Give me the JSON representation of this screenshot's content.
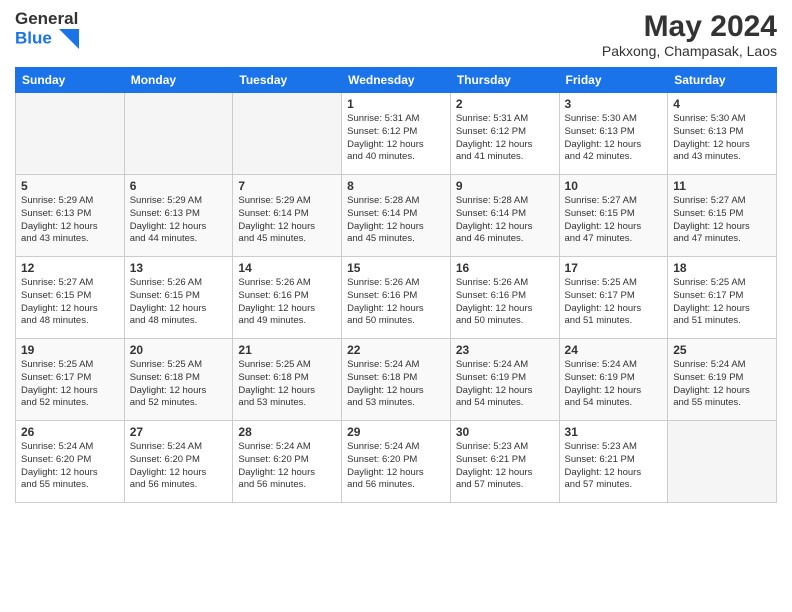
{
  "logo": {
    "line1": "General",
    "line2": "Blue"
  },
  "title": "May 2024",
  "subtitle": "Pakxong, Champasak, Laos",
  "days_of_week": [
    "Sunday",
    "Monday",
    "Tuesday",
    "Wednesday",
    "Thursday",
    "Friday",
    "Saturday"
  ],
  "weeks": [
    [
      {
        "day": "",
        "info": ""
      },
      {
        "day": "",
        "info": ""
      },
      {
        "day": "",
        "info": ""
      },
      {
        "day": "1",
        "info": "Sunrise: 5:31 AM\nSunset: 6:12 PM\nDaylight: 12 hours\nand 40 minutes."
      },
      {
        "day": "2",
        "info": "Sunrise: 5:31 AM\nSunset: 6:12 PM\nDaylight: 12 hours\nand 41 minutes."
      },
      {
        "day": "3",
        "info": "Sunrise: 5:30 AM\nSunset: 6:13 PM\nDaylight: 12 hours\nand 42 minutes."
      },
      {
        "day": "4",
        "info": "Sunrise: 5:30 AM\nSunset: 6:13 PM\nDaylight: 12 hours\nand 43 minutes."
      }
    ],
    [
      {
        "day": "5",
        "info": "Sunrise: 5:29 AM\nSunset: 6:13 PM\nDaylight: 12 hours\nand 43 minutes."
      },
      {
        "day": "6",
        "info": "Sunrise: 5:29 AM\nSunset: 6:13 PM\nDaylight: 12 hours\nand 44 minutes."
      },
      {
        "day": "7",
        "info": "Sunrise: 5:29 AM\nSunset: 6:14 PM\nDaylight: 12 hours\nand 45 minutes."
      },
      {
        "day": "8",
        "info": "Sunrise: 5:28 AM\nSunset: 6:14 PM\nDaylight: 12 hours\nand 45 minutes."
      },
      {
        "day": "9",
        "info": "Sunrise: 5:28 AM\nSunset: 6:14 PM\nDaylight: 12 hours\nand 46 minutes."
      },
      {
        "day": "10",
        "info": "Sunrise: 5:27 AM\nSunset: 6:15 PM\nDaylight: 12 hours\nand 47 minutes."
      },
      {
        "day": "11",
        "info": "Sunrise: 5:27 AM\nSunset: 6:15 PM\nDaylight: 12 hours\nand 47 minutes."
      }
    ],
    [
      {
        "day": "12",
        "info": "Sunrise: 5:27 AM\nSunset: 6:15 PM\nDaylight: 12 hours\nand 48 minutes."
      },
      {
        "day": "13",
        "info": "Sunrise: 5:26 AM\nSunset: 6:15 PM\nDaylight: 12 hours\nand 48 minutes."
      },
      {
        "day": "14",
        "info": "Sunrise: 5:26 AM\nSunset: 6:16 PM\nDaylight: 12 hours\nand 49 minutes."
      },
      {
        "day": "15",
        "info": "Sunrise: 5:26 AM\nSunset: 6:16 PM\nDaylight: 12 hours\nand 50 minutes."
      },
      {
        "day": "16",
        "info": "Sunrise: 5:26 AM\nSunset: 6:16 PM\nDaylight: 12 hours\nand 50 minutes."
      },
      {
        "day": "17",
        "info": "Sunrise: 5:25 AM\nSunset: 6:17 PM\nDaylight: 12 hours\nand 51 minutes."
      },
      {
        "day": "18",
        "info": "Sunrise: 5:25 AM\nSunset: 6:17 PM\nDaylight: 12 hours\nand 51 minutes."
      }
    ],
    [
      {
        "day": "19",
        "info": "Sunrise: 5:25 AM\nSunset: 6:17 PM\nDaylight: 12 hours\nand 52 minutes."
      },
      {
        "day": "20",
        "info": "Sunrise: 5:25 AM\nSunset: 6:18 PM\nDaylight: 12 hours\nand 52 minutes."
      },
      {
        "day": "21",
        "info": "Sunrise: 5:25 AM\nSunset: 6:18 PM\nDaylight: 12 hours\nand 53 minutes."
      },
      {
        "day": "22",
        "info": "Sunrise: 5:24 AM\nSunset: 6:18 PM\nDaylight: 12 hours\nand 53 minutes."
      },
      {
        "day": "23",
        "info": "Sunrise: 5:24 AM\nSunset: 6:19 PM\nDaylight: 12 hours\nand 54 minutes."
      },
      {
        "day": "24",
        "info": "Sunrise: 5:24 AM\nSunset: 6:19 PM\nDaylight: 12 hours\nand 54 minutes."
      },
      {
        "day": "25",
        "info": "Sunrise: 5:24 AM\nSunset: 6:19 PM\nDaylight: 12 hours\nand 55 minutes."
      }
    ],
    [
      {
        "day": "26",
        "info": "Sunrise: 5:24 AM\nSunset: 6:20 PM\nDaylight: 12 hours\nand 55 minutes."
      },
      {
        "day": "27",
        "info": "Sunrise: 5:24 AM\nSunset: 6:20 PM\nDaylight: 12 hours\nand 56 minutes."
      },
      {
        "day": "28",
        "info": "Sunrise: 5:24 AM\nSunset: 6:20 PM\nDaylight: 12 hours\nand 56 minutes."
      },
      {
        "day": "29",
        "info": "Sunrise: 5:24 AM\nSunset: 6:20 PM\nDaylight: 12 hours\nand 56 minutes."
      },
      {
        "day": "30",
        "info": "Sunrise: 5:23 AM\nSunset: 6:21 PM\nDaylight: 12 hours\nand 57 minutes."
      },
      {
        "day": "31",
        "info": "Sunrise: 5:23 AM\nSunset: 6:21 PM\nDaylight: 12 hours\nand 57 minutes."
      },
      {
        "day": "",
        "info": ""
      }
    ]
  ]
}
